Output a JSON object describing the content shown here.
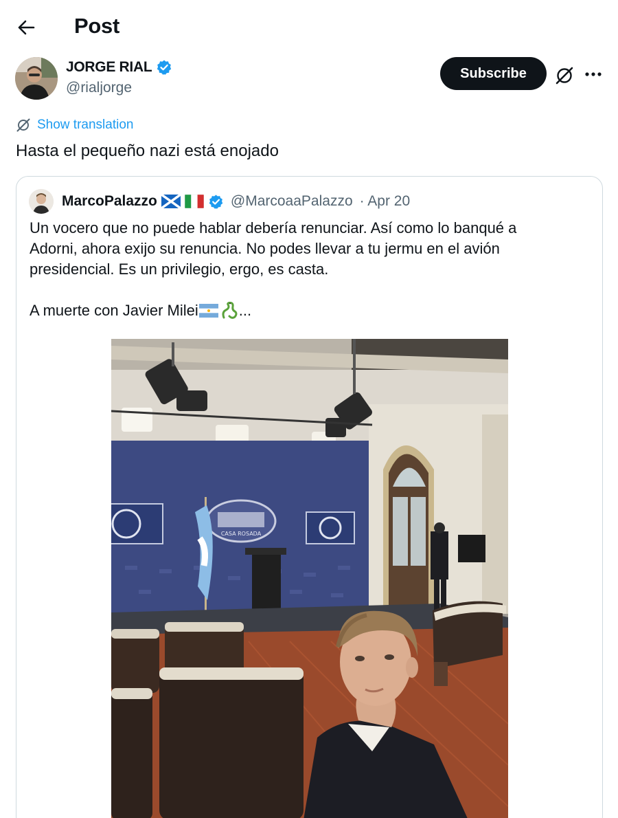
{
  "header": {
    "title": "Post",
    "back_icon": "arrow-left-icon"
  },
  "author": {
    "name": "JORGE RIAL",
    "handle": "@rialjorge",
    "verified": true,
    "verified_color": "#1d9bf0",
    "subscribe_label": "Subscribe"
  },
  "post": {
    "translate_label": "Show translation",
    "text": "Hasta el pequeño nazi está enojado"
  },
  "quote": {
    "name": "MarcoPalazzo",
    "flags": [
      "scotland-flag",
      "italy-flag"
    ],
    "verified": true,
    "handle": "@MarcoaaPalazzo",
    "date": "· Apr 20",
    "line1": "Un vocero que no puede hablar debería renunciar. Así como lo banqué a",
    "line2": "Adorni, ahora exijo su renuncia. No podes llevar a tu jermu en el avión",
    "line3": "presidencial. Es un privilegio, ergo, es casta.",
    "line4_prefix": "A muerte con Javier Milei",
    "line4_suffix": "...",
    "image": {
      "backdrop_text": "CASA ROSADA"
    }
  },
  "colors": {
    "accent": "#1d9bf0",
    "text": "#0f1419",
    "secondary": "#536471",
    "border": "#cfd9de"
  }
}
